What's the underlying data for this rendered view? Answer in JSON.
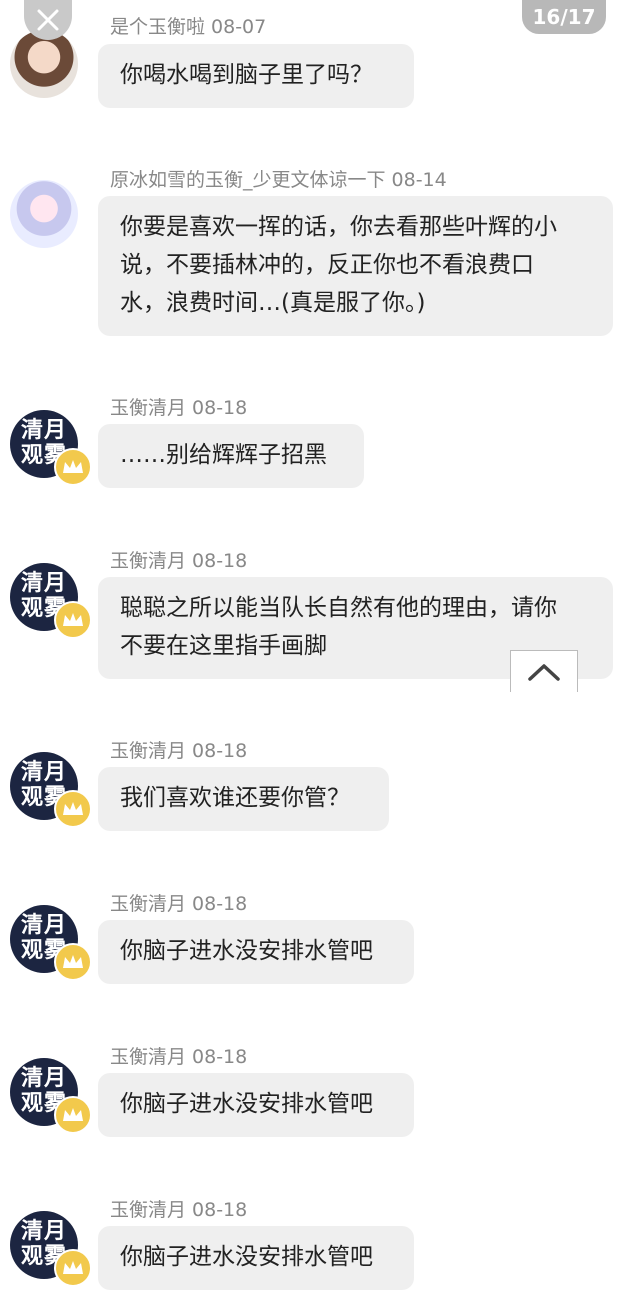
{
  "viewer": {
    "page_indicator": "16/17"
  },
  "qy_avatar_text": {
    "line1": "清月",
    "line2": "观雾"
  },
  "messages": [
    {
      "author": "是个玉衡啦",
      "date": "08-07",
      "text": "你喝水喝到脑子里了吗？"
    },
    {
      "author": "原冰如雪的玉衡_少更文体谅一下",
      "date": "08-14",
      "lines": [
        "你要是喜欢一挥的话，你去看那些叶辉的小",
        "说，不要插林冲的，反正你也不看浪费口",
        "水，浪费时间…(真是服了你。)"
      ]
    },
    {
      "author": "玉衡清月",
      "date": "08-18",
      "text": "……别给辉辉子招黑"
    },
    {
      "author": "玉衡清月",
      "date": "08-18",
      "lines": [
        "聪聪之所以能当队长自然有他的理由，请你",
        "不要在这里指手画脚"
      ]
    },
    {
      "author": "玉衡清月",
      "date": "08-18",
      "text": "我们喜欢谁还要你管？"
    },
    {
      "author": "玉衡清月",
      "date": "08-18",
      "text": "你脑子进水没安排水管吧"
    },
    {
      "author": "玉衡清月",
      "date": "08-18",
      "text": "你脑子进水没安排水管吧"
    },
    {
      "author": "玉衡清月",
      "date": "08-18",
      "text": "你脑子进水没安排水管吧"
    }
  ],
  "icons": {
    "close": "close-icon",
    "scroll_up": "chevron-up-icon",
    "badge": "crown-icon"
  },
  "colors": {
    "bubble": "#efefef",
    "meta_text": "#888888",
    "avatar_dark": "#1c2541",
    "crown": "#f2c94c"
  }
}
